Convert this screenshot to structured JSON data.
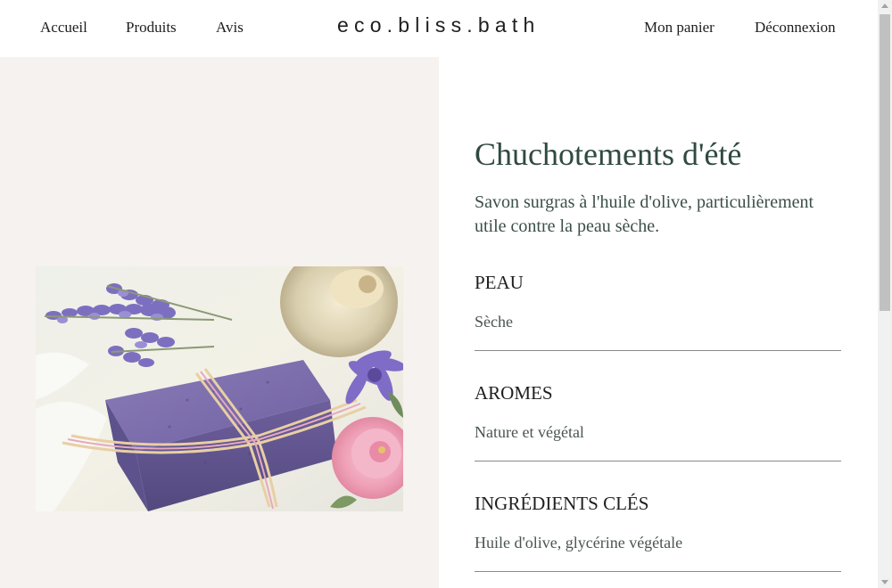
{
  "nav": {
    "accueil": "Accueil",
    "produits": "Produits",
    "avis": "Avis",
    "panier": "Mon panier",
    "deconnexion": "Déconnexion"
  },
  "brand": "eco.bliss.bath",
  "product": {
    "title": "Chuchotements d'été",
    "description": "Savon surgras à l'huile d'olive, particulièrement utile contre la peau sèche.",
    "image_icon": "soap-photo",
    "attributes": [
      {
        "label": "PEAU",
        "value": "Sèche"
      },
      {
        "label": "AROMES",
        "value": "Nature et végétal"
      },
      {
        "label": "INGRÉDIENTS CLÉS",
        "value": "Huile d'olive, glycérine végétale"
      }
    ]
  },
  "colors": {
    "panel_background": "#f6f2ef",
    "title": "#2f4a40",
    "divider": "#8a8a8a"
  }
}
